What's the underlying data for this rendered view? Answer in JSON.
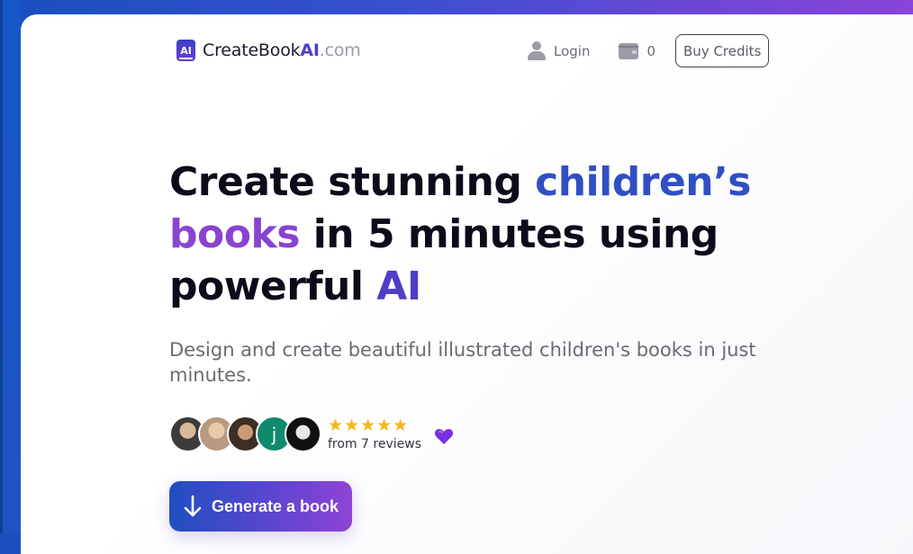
{
  "logo": {
    "mark": "AI",
    "name_prefix": "CreateBook",
    "name_ai": "AI",
    "name_domain": ".com"
  },
  "nav": {
    "login_label": "Login",
    "credits_count": "0",
    "buy_credits_label": "Buy Credits"
  },
  "hero": {
    "headline_part1": "Create stunning ",
    "headline_highlight1": "children’s",
    "headline_highlight2": "books",
    "headline_part2": " in 5 minutes using powerful ",
    "headline_highlight3": "AI",
    "subtitle": "Design and create beautiful illustrated children's books in just minutes.",
    "reviews_text": "from 7 reviews",
    "stars": "★★★★★",
    "star_count": 5,
    "avatar_letter": "j",
    "cta_label": "Generate a book"
  },
  "colors": {
    "accent_blue": "#2f4fc3",
    "accent_purple": "#8a43cf",
    "star": "#f6b51e"
  },
  "icons": [
    "user-icon",
    "wallet-icon",
    "star-icon",
    "heart-icon",
    "arrow-down-icon"
  ]
}
